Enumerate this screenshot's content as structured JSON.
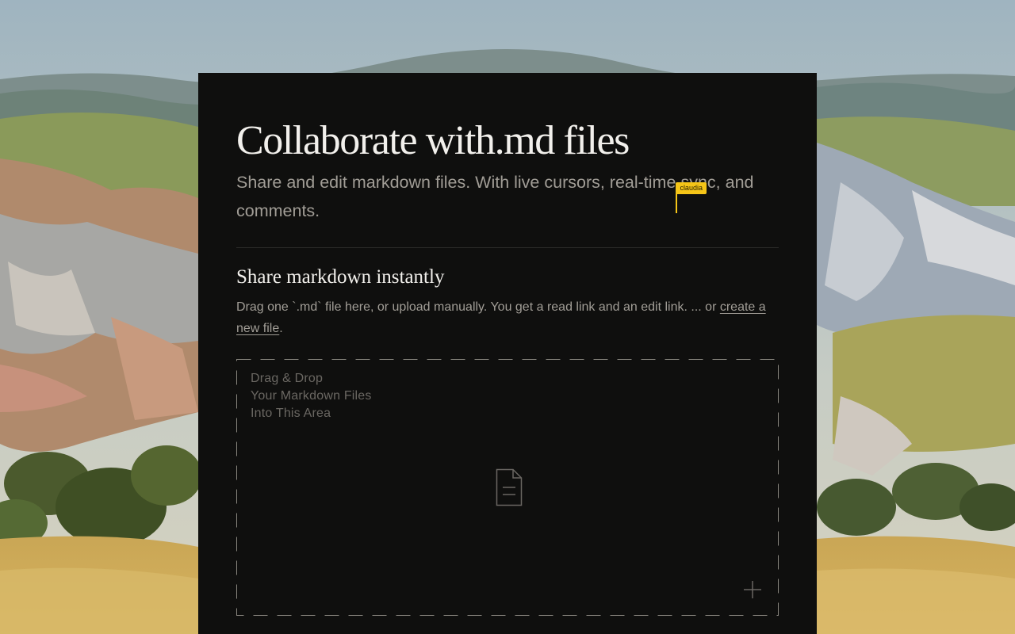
{
  "hero": {
    "title": "Collaborate with.md files",
    "subtitle_before": "Share and edit markdown files. With live cursors, real-time",
    "subtitle_after": "sync,",
    "subtitle_end": "and comments.",
    "cursor_user": "claudia"
  },
  "section": {
    "title": "Share markdown instantly",
    "description": "Drag one `.md` file here, or upload manually. You get a read link and an edit link. ... or",
    "new_file_link": "create a new file",
    "new_file_suffix": "."
  },
  "dropzone": {
    "line1": "Drag & Drop",
    "line2": "Your Markdown Files",
    "line3": "Into This Area",
    "file_icon": "document-icon",
    "add_icon": "plus-icon"
  },
  "colors": {
    "card_bg": "#0f0f0e",
    "title": "#f2f0ec",
    "muted_text": "#a19d96",
    "cursor_accent": "#f5c518"
  }
}
